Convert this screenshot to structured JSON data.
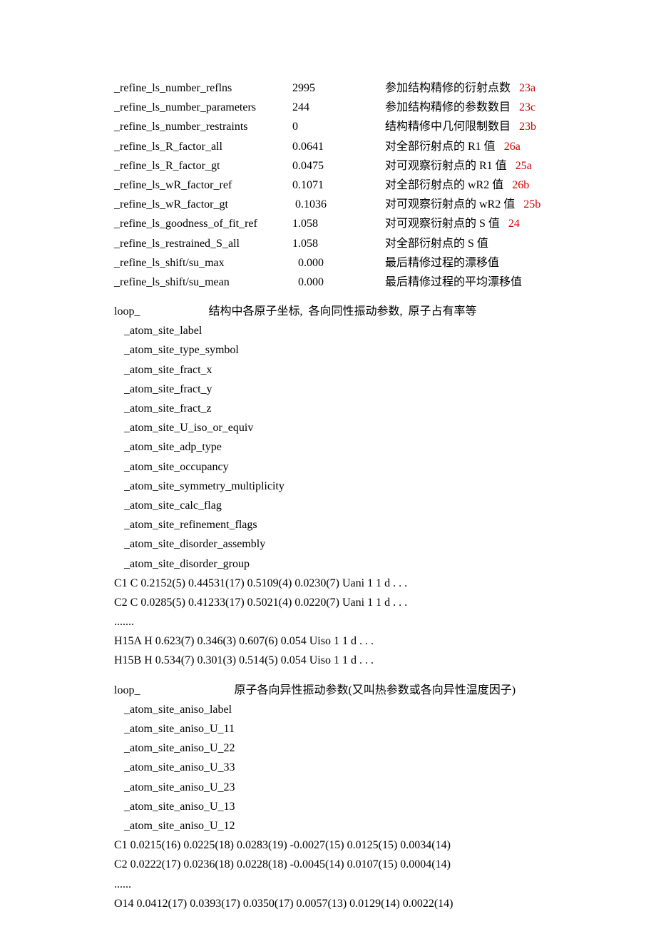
{
  "refine": [
    {
      "key": "_refine_ls_number_reflns",
      "val": "2995",
      "desc": "参加结构精修的衍射点数",
      "ref": "23a"
    },
    {
      "key": "_refine_ls_number_parameters",
      "val": "244",
      "desc": "参加结构精修的参数数目",
      "ref": "23c"
    },
    {
      "key": "_refine_ls_number_restraints",
      "val": "0",
      "desc": "结构精修中几何限制数目",
      "ref": "23b"
    },
    {
      "key": "_refine_ls_R_factor_all",
      "val": "0.0641",
      "desc": "对全部衍射点的 R1 值",
      "ref": "26a"
    },
    {
      "key": "_refine_ls_R_factor_gt",
      "val": "0.0475",
      "desc": "对可观察衍射点的 R1 值",
      "ref": "25a"
    },
    {
      "key": "_refine_ls_wR_factor_ref",
      "val": "0.1071",
      "desc": "对全部衍射点的 wR2 值",
      "ref": "26b"
    },
    {
      "key": "_refine_ls_wR_factor_gt",
      "val": " 0.1036",
      "desc": "对可观察衍射点的 wR2 值",
      "ref": "25b"
    },
    {
      "key": "_refine_ls_goodness_of_fit_ref",
      "val": "1.058",
      "desc": "对可观察衍射点的 S 值",
      "ref": "24"
    },
    {
      "key": "_refine_ls_restrained_S_all",
      "val": "1.058",
      "desc": "对全部衍射点的 S 值",
      "ref": ""
    },
    {
      "key": "_refine_ls_shift/su_max",
      "val": "  0.000",
      "desc": "最后精修过程的漂移值",
      "ref": ""
    },
    {
      "key": "_refine_ls_shift/su_mean",
      "val": "  0.000",
      "desc": "最后精修过程的平均漂移值",
      "ref": ""
    }
  ],
  "loop1": {
    "head": "loop_",
    "comment": "结构中各原子坐标,  各向同性振动参数,  原子占有率等",
    "fields": [
      "_atom_site_label",
      "_atom_site_type_symbol",
      "_atom_site_fract_x",
      "_atom_site_fract_y",
      "_atom_site_fract_z",
      "_atom_site_U_iso_or_equiv",
      "_atom_site_adp_type",
      "_atom_site_occupancy",
      "_atom_site_symmetry_multiplicity",
      "_atom_site_calc_flag",
      "_atom_site_refinement_flags",
      "_atom_site_disorder_assembly",
      "_atom_site_disorder_group"
    ],
    "data": [
      "C1 C 0.2152(5) 0.44531(17) 0.5109(4) 0.0230(7) Uani 1 1 d . . .",
      "C2 C 0.0285(5) 0.41233(17) 0.5021(4) 0.0220(7) Uani 1 1 d . . .",
      ".......",
      "H15A H 0.623(7) 0.346(3) 0.607(6) 0.054 Uiso 1 1 d . . .",
      "H15B H 0.534(7) 0.301(3) 0.514(5) 0.054 Uiso 1 1 d . . ."
    ]
  },
  "loop2": {
    "head": "loop_",
    "comment": "原子各向异性振动参数(又叫热参数或各向异性温度因子)",
    "fields": [
      "_atom_site_aniso_label",
      "_atom_site_aniso_U_11",
      "_atom_site_aniso_U_22",
      "_atom_site_aniso_U_33",
      "_atom_site_aniso_U_23",
      "_atom_site_aniso_U_13",
      "_atom_site_aniso_U_12"
    ],
    "data": [
      "C1 0.0215(16) 0.0225(18) 0.0283(19) -0.0027(15) 0.0125(15) 0.0034(14)",
      "C2 0.0222(17) 0.0236(18) 0.0228(18) -0.0045(14) 0.0107(15) 0.0004(14)",
      "......",
      "O14 0.0412(17) 0.0393(17) 0.0350(17) 0.0057(13) 0.0129(14) 0.0022(14)"
    ]
  }
}
